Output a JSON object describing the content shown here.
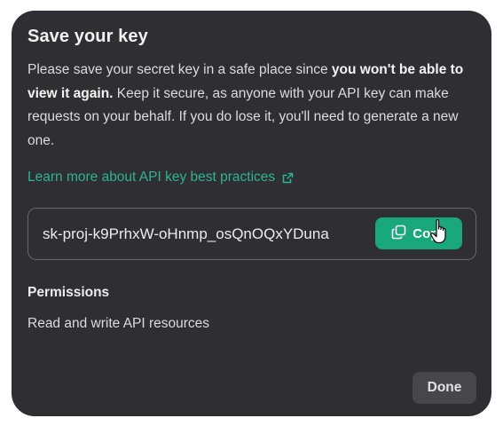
{
  "dialog": {
    "title": "Save your key",
    "description": {
      "before": "Please save your secret key in a safe place since ",
      "emphasis": "you won't be able to view it again.",
      "after": " Keep it secure, as anyone with your API key can make requests on your behalf. If you do lose it, you'll need to generate a new one."
    },
    "learn_more": {
      "label": "Learn more about API key best practices",
      "icon": "external-link-icon"
    },
    "secret_key": {
      "value": "sk-proj-k9PrhxW-oHnmp_osQnOQxYDuna"
    },
    "copy_button": {
      "label": "Copy",
      "icon": "copy-icon"
    },
    "permissions": {
      "heading": "Permissions",
      "value": "Read and write API resources"
    },
    "done_button": {
      "label": "Done"
    }
  },
  "colors": {
    "dialog_background": "#2f2f33",
    "accent": "#19a87c",
    "link": "#2fb48d"
  }
}
